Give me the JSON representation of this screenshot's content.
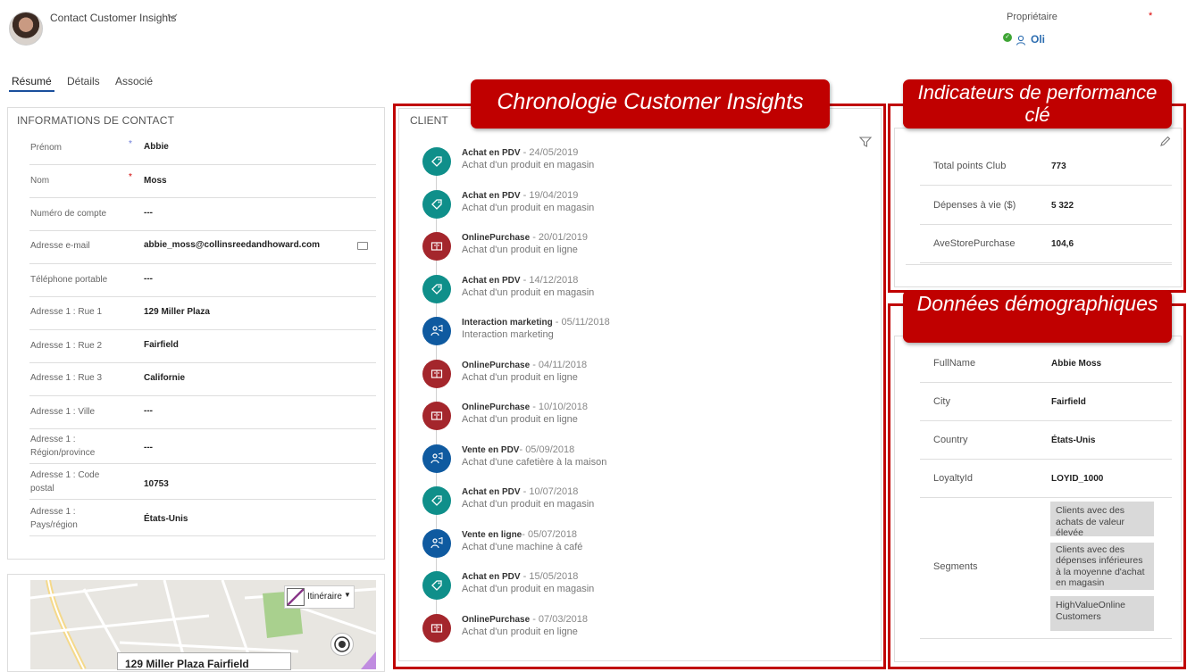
{
  "header": {
    "record_title": "Contact Customer Insights",
    "owner_label": "Propriétaire",
    "owner_required": "*",
    "owner_name": "Oli"
  },
  "tabs": [
    {
      "label": "Résumé",
      "active": true
    },
    {
      "label": "Détails"
    },
    {
      "label": "Associé"
    }
  ],
  "contact_info": {
    "heading": "INFORMATIONS DE CONTACT",
    "fields": [
      {
        "label": "Prénom",
        "value": "Abbie",
        "required": "*",
        "required_color": "#6b7bd8"
      },
      {
        "label": "Nom",
        "value": "Moss",
        "required": "*",
        "required_color": "#d00000"
      },
      {
        "label": "Numéro de compte",
        "value": "---"
      },
      {
        "label": "Adresse e-mail",
        "value": "abbie_moss@collinsreedandhoward.com"
      },
      {
        "label": "Téléphone portable",
        "value": "---"
      },
      {
        "label": "Adresse 1 : Rue 1",
        "value": "129 Miller Plaza"
      },
      {
        "label": "Adresse 1 : Rue 2",
        "value": "Fairfield"
      },
      {
        "label": "Adresse 1 : Rue 3",
        "value": "Californie"
      },
      {
        "label": "Adresse 1 : Ville",
        "value": "---"
      },
      {
        "label": "Adresse 1 : Région/province",
        "value": "---"
      },
      {
        "label": "Adresse 1 : Code postal",
        "value": "10753"
      },
      {
        "label": "Adresse 1 : Pays/région",
        "value": "États-Unis"
      }
    ]
  },
  "map": {
    "route_button": "Itinéraire",
    "address_label": "129 Miller Plaza Fairfield"
  },
  "timeline": {
    "heading": "CLIENT",
    "callout": "Chronologie Customer Insights",
    "items": [
      {
        "title": "Achat en PDV",
        "date": " - 24/05/2019",
        "desc": "Achat d'un produit en magasin",
        "kind": "store",
        "color": "#0f8f8a"
      },
      {
        "title": "Achat en PDV",
        "date": " - 19/04/2019",
        "desc": "Achat d'un produit en magasin",
        "kind": "store",
        "color": "#0f8f8a"
      },
      {
        "title": "OnlinePurchase",
        "date": " - 20/01/2019",
        "desc": "Achat d'un produit en ligne",
        "kind": "online",
        "color": "#a4262c"
      },
      {
        "title": "Achat en PDV",
        "date": " - 14/12/2018",
        "desc": "Achat d'un produit en magasin",
        "kind": "store",
        "color": "#0f8f8a"
      },
      {
        "title": "Interaction marketing",
        "date": " - 05/11/2018",
        "desc": "Interaction marketing",
        "kind": "person",
        "color": "#0f5aa0"
      },
      {
        "title": "OnlinePurchase",
        "date": " - 04/11/2018",
        "desc": "Achat d'un produit en ligne",
        "kind": "online",
        "color": "#a4262c"
      },
      {
        "title": "OnlinePurchase",
        "date": " - 10/10/2018",
        "desc": "Achat d'un produit en ligne",
        "kind": "online",
        "color": "#a4262c"
      },
      {
        "title": "Vente en PDV",
        "date": "- 05/09/2018",
        "desc": "Achat d'une cafetière à la maison",
        "kind": "person",
        "color": "#0f5aa0"
      },
      {
        "title": "Achat en PDV",
        "date": " - 10/07/2018",
        "desc": "Achat d'un produit en magasin",
        "kind": "store",
        "color": "#0f8f8a"
      },
      {
        "title": "Vente en ligne",
        "date": "- 05/07/2018",
        "desc": "Achat d'une machine à café",
        "kind": "person",
        "color": "#0f5aa0"
      },
      {
        "title": "Achat en PDV",
        "date": " - 15/05/2018",
        "desc": "Achat d'un produit en magasin",
        "kind": "store",
        "color": "#0f8f8a"
      },
      {
        "title": "OnlinePurchase",
        "date": " - 07/03/2018",
        "desc": "Achat d'un produit en ligne",
        "kind": "online",
        "color": "#a4262c"
      }
    ]
  },
  "kpi": {
    "callout": "Indicateurs de performance clé",
    "items": [
      {
        "label": "Total points Club",
        "value": "773"
      },
      {
        "label": "Dépenses à vie ($)",
        "value": "5 322"
      },
      {
        "label": "AveStorePurchase",
        "value": "104,6"
      }
    ]
  },
  "demographics": {
    "callout": "Données démographiques",
    "items": [
      {
        "label": "FullName",
        "value": "Abbie Moss"
      },
      {
        "label": "City",
        "value": "Fairfield"
      },
      {
        "label": "Country",
        "value": "États-Unis"
      },
      {
        "label": "LoyaltyId",
        "value": "LOYID_1000"
      }
    ],
    "segments_label": "Segments",
    "segments": [
      "Clients avec des achats de valeur élevée",
      "Clients avec des dépenses inférieures à la moyenne d'achat en magasin",
      "HighValueOnline Customers"
    ]
  },
  "icons": {
    "store": "tag-icon",
    "online": "shopping-bag-icon",
    "person": "marketing-person-icon",
    "filter": "filter-icon",
    "edit": "pencil-icon"
  }
}
